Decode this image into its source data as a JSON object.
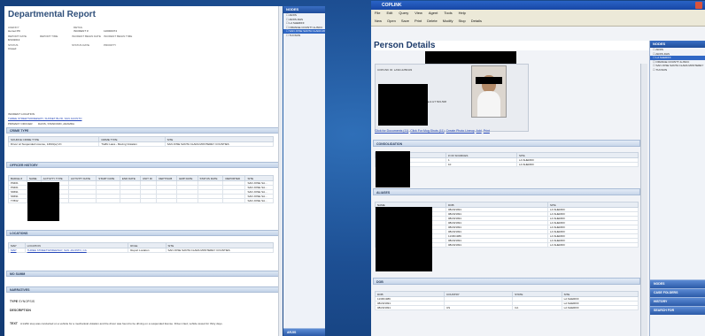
{
  "left": {
    "title": "Departmental Report",
    "fields": [
      {
        "label": "AGENCY",
        "value": "Hemet PD"
      },
      {
        "label": "DETAIL",
        "value": "INCIDENT #"
      },
      {
        "label": "",
        "value": "120000374"
      },
      {
        "label": "REPORT DATE",
        "value": "8/13/2013"
      },
      {
        "label": "REPORT TIME",
        "value": ""
      },
      {
        "label": "INCIDENT BEGIN DATE",
        "value": ""
      },
      {
        "label": "INCIDENT BEGIN TIME",
        "value": ""
      },
      {
        "label": "STATUS",
        "value": "Closed"
      },
      {
        "label": "STATUS DATE",
        "value": ""
      },
      {
        "label": "PRIORITY",
        "value": ""
      }
    ],
    "incident_location_label": "INCIDENT LOCATION",
    "incident_location": "THREE STREETS/FREEWAY, SUNSET BLVD, SAN JACINTO",
    "primary_officer_label": "PRIMARY OFFICER",
    "primary_officer": "DAVIS, STANFORD, ARAMDA",
    "sections": {
      "crime_type": "CRIME TYPE",
      "officer_history": "OFFICER HISTORY",
      "locations": "LOCATIONS",
      "modus": "MO SUMM",
      "narratives": "NARRATIVES"
    },
    "crime_cols": [
      "SOURCE CRIME TYPE",
      "CRIME TYPE",
      "SITE"
    ],
    "crime_row": [
      "Driver w/ Suspended License, 14601(a) VC",
      "Traffic Laws - Moving Violation",
      "SAN JOSE SANTA CLARA MONTEREY COUNTIES"
    ],
    "officer_cols": [
      "BADGE #",
      "NAME",
      "ACTIVITY TYPE",
      "ACTIVITY DATE",
      "START DATE",
      "END DATE",
      "UNIT ID",
      "DEPT/SUB",
      "EMP DATE",
      "STATUS DATE",
      "REPORTED",
      "SITE"
    ],
    "officer_rows": [
      [
        "P9461",
        "",
        "BACK UP",
        "",
        "",
        "",
        "",
        "",
        "",
        "",
        "",
        "SAN JOSE SA..."
      ],
      [
        "P9461",
        "",
        "BACK UP",
        "",
        "",
        "",
        "",
        "",
        "",
        "",
        "",
        "SAN JOSE SA..."
      ],
      [
        "S6691",
        "",
        "PRIMARY",
        "",
        "",
        "",
        "",
        "",
        "",
        "",
        "",
        "SAN JOSE SA..."
      ],
      [
        "S6691",
        "",
        "SUBJECT",
        "",
        "",
        "",
        "",
        "",
        "",
        "",
        "",
        "SAN JOSE SA..."
      ],
      [
        "T7832",
        "",
        "BACK UP",
        "",
        "",
        "",
        "",
        "",
        "",
        "",
        "",
        "SAN JOSE SA..."
      ]
    ],
    "loc_cols": [
      "MAP",
      "LOCATION",
      "ROLE",
      "SITE"
    ],
    "loc_row": [
      "MAP",
      "THREE STREETS/FREEWAY, SAN JACINTO, CA",
      "Report Location",
      "SAN JOSE SANTA CLARA MONTEREY COUNTIES"
    ],
    "narrative_type_label": "TYPE",
    "narrative_type": "SYNOPSIS",
    "description_label": "DESCRIPTION",
    "narr_text_label": "TEXT",
    "narr_text": "A traffic stop was conducted on a vehicle for a mechanical violation and the driver was found to be driving on a suspended license. Driver cited, vehicle towed for thirty days."
  },
  "nodes_left": {
    "header": "NODES",
    "items": [
      "ARJIS",
      "ARJIS.DHS",
      "LA SHERIFF",
      "ORANGE COUNTY-ILJNCC",
      "SAN JOSE SANTA CLARA MONTEREY",
      "TUCSON"
    ],
    "selected_index": 4,
    "bottom_tab": "ARJIS"
  },
  "right": {
    "app_title": "COPLINK",
    "menu": [
      "File",
      "Edit",
      "Query",
      "View",
      "Agent",
      "Tools",
      "Help"
    ],
    "toolbar": [
      "New",
      "Open",
      "Save",
      "Print",
      "Delete",
      "Modify",
      "Stop",
      "Details"
    ],
    "page_title": "Person Details",
    "person_id_label": "COPLINK ID:",
    "person_id": "LASD-2256433",
    "attr_line1": "Black  HT 503-508",
    "attr_line2": "Black  Hispanic  WT 119-160",
    "attr_brown": "Brown",
    "links": [
      "Click for Documents (11)",
      "Click For Mug Shots (11)",
      "Create Photo Lineup",
      "Add",
      "Print"
    ],
    "consolidation_hdr": "CONSOLIDATION",
    "cons_cols": [
      "",
      "# OF SOURCES",
      "SITE"
    ],
    "cons_rows": [
      [
        "",
        "1",
        "LA SHERIFF"
      ],
      [
        "",
        "10",
        "LA SHERIFF"
      ]
    ],
    "aliases_hdr": "ALIASES",
    "alias_cols": [
      "NAME",
      "DOB",
      "SITE"
    ],
    "alias_rows": [
      [
        "",
        "08/20/1991",
        "LA SHERIFF"
      ],
      [
        "",
        "08/20/1991",
        "LA SHERIFF"
      ],
      [
        "",
        "08/20/1991",
        "LA SHERIFF"
      ],
      [
        "",
        "08/20/1991",
        "LA SHERIFF"
      ],
      [
        "",
        "08/20/1991",
        "LA SHERIFF"
      ],
      [
        "",
        "08/20/1991",
        "LA SHERIFF"
      ],
      [
        "",
        "11/06/1989",
        "LA SHERIFF"
      ],
      [
        "",
        "08/20/1991",
        "LA SHERIFF"
      ],
      [
        "",
        "08/20/1991",
        "LA SHERIFF"
      ]
    ],
    "dob_hdr": "DOB",
    "dob_cols": [
      "DOB",
      "COUNTRY",
      "STATE",
      "SITE"
    ],
    "dob_rows": [
      [
        "11/06/1989",
        "",
        "",
        "LA SHERIFF"
      ],
      [
        "08/20/1991",
        "",
        "",
        "LA SHERIFF"
      ],
      [
        "08/20/1991",
        "US",
        "CA",
        "LA SHERIFF"
      ]
    ]
  },
  "nodes_right": {
    "header": "NODES",
    "items": [
      "ARJIS",
      "ARJIS.DHS",
      "LA SHERIFF",
      "ORANGE COUNTY-ILJNCC",
      "SAN JOSE SANTA CLARA MONTEREY",
      "TUCSON"
    ],
    "selected_index": 2,
    "accordion": [
      "NODES",
      "CASE FOLDERS",
      "HISTORY",
      "SEARCH FOR"
    ]
  }
}
